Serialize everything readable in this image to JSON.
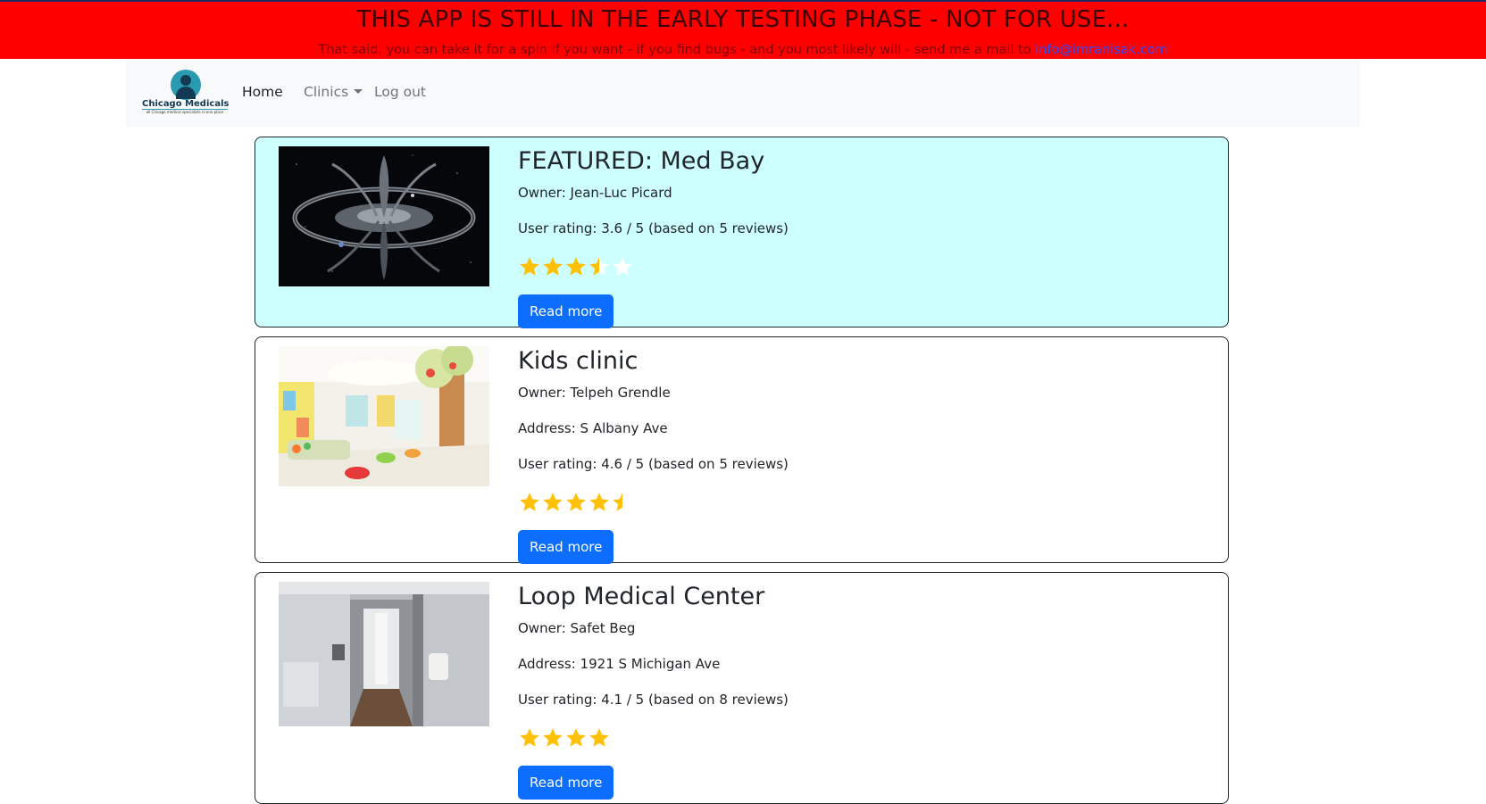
{
  "banner": {
    "title": "THIS APP IS STILL IN THE EARLY TESTING PHASE - NOT FOR USE...",
    "subtitle": "That said, you can take it for a spin if you want - if you find bugs - and you most likely will - send me a mail to",
    "email": "info@imranisak.com"
  },
  "navbar": {
    "brand": {
      "name": "Chicago Medicals",
      "tagline": "all Chicago medical specialists in one place"
    },
    "links": [
      {
        "label": "Home"
      },
      {
        "label": "Clinics"
      },
      {
        "label": "Log out"
      }
    ]
  },
  "clinics": [
    {
      "title": "FEATURED: Med Bay",
      "owner": "Owner: Jean-Luc Picard",
      "rating_text": "User rating: 3.6 / 5 (based on 5 reviews)",
      "rating": 3.6,
      "featured": true,
      "image": "space-station-photo",
      "button": "Read more"
    },
    {
      "title": "Kids clinic",
      "owner": "Owner: Telpeh Grendle",
      "address": "Address: S Albany Ave",
      "rating_text": "User rating: 4.6 / 5 (based on 5 reviews)",
      "rating": 4.6,
      "featured": false,
      "image": "kids-waiting-room-photo",
      "button": "Read more"
    },
    {
      "title": "Loop Medical Center",
      "owner": "Owner: Safet Beg",
      "address": "Address: 1921 S Michigan Ave",
      "rating_text": "User rating: 4.1 / 5 (based on 8 reviews)",
      "rating": 4.1,
      "featured": false,
      "image": "clinic-hallway-photo",
      "button": "Read more"
    }
  ],
  "colors": {
    "banner_bg": "#ff0000",
    "featured_bg": "#ccfffe",
    "button_bg": "#0d6efd",
    "star": "#ffc107"
  }
}
